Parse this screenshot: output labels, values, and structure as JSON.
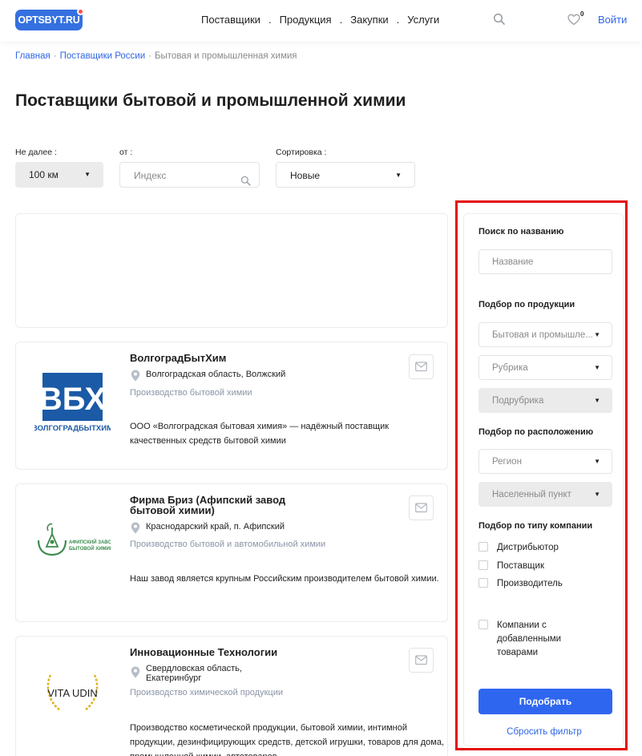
{
  "header": {
    "logo": "OPTSBYT.RU",
    "nav": [
      "Поставщики",
      "Продукция",
      "Закупки",
      "Услуги"
    ],
    "nav_sep": ".",
    "favorites_count": "0",
    "login": "Войти"
  },
  "breadcrumb": {
    "home": "Главная",
    "section": "Поставщики России",
    "current": "Бытовая и промышленная химия",
    "sep": "·"
  },
  "page_title": "Поставщики бытовой и промышленной химии",
  "filters": {
    "distance_label": "Не далее :",
    "distance_value": "100 км",
    "from_label": "от :",
    "from_placeholder": "Индекс",
    "sort_label": "Сортировка :",
    "sort_value": "Новые"
  },
  "cards": [
    {
      "name": "ВолгоградБытХим",
      "location": "Волгоградская область, Волжский",
      "category": "Производство бытовой химии",
      "description": "ООО «Волгоградская бытовая химия» — надёжный поставщик качественных средств бытовой химии",
      "logo_text": "ВБХ",
      "logo_sub": "ВОЛГОГРАДБЫТХИМ"
    },
    {
      "name": "Фирма Бриз (Афипский завод бытовой химии)",
      "location": "Краснодарский край, п. Афипский",
      "category": "Производство бытовой и автомобильной химии",
      "description": "Наш завод является крупным Российским производителем бытовой химии.",
      "logo_text_1": "АФИПСКИЙ ЗАВОД",
      "logo_text_2": "БЫТОВОЙ ХИМИИ"
    },
    {
      "name": "Инновационные Технологии",
      "location": "Свердловская область, Екатеринбург",
      "category": "Производство химической продукции",
      "description": "Производство косметической продукции, бытовой химии, интимной продукции, дезинфицирующих средств, детской игрушки, товаров для дома, промышленной химии, автотоваров",
      "logo_text": "VITA UDIN"
    }
  ],
  "sidebar": {
    "name_title": "Поиск по названию",
    "name_placeholder": "Название",
    "product_title": "Подбор по продукции",
    "product_value": "Бытовая и промышле...",
    "rubric": "Рубрика",
    "subrubric": "Подрубрика",
    "location_title": "Подбор по расположению",
    "region": "Регион",
    "city": "Населенный пункт",
    "type_title": "Подбор по типу компании",
    "types": [
      "Дистрибьютор",
      "Поставщик",
      "Производитель"
    ],
    "with_products": "Компании с добавленными товарами",
    "apply": "Подобрать",
    "reset": "Сбросить фильтр"
  },
  "colors": {
    "accent": "#2f66f0",
    "highlight": "#e30b0b",
    "logo_blue": "#1b5aa6",
    "logo_green": "#3d8b4f"
  }
}
